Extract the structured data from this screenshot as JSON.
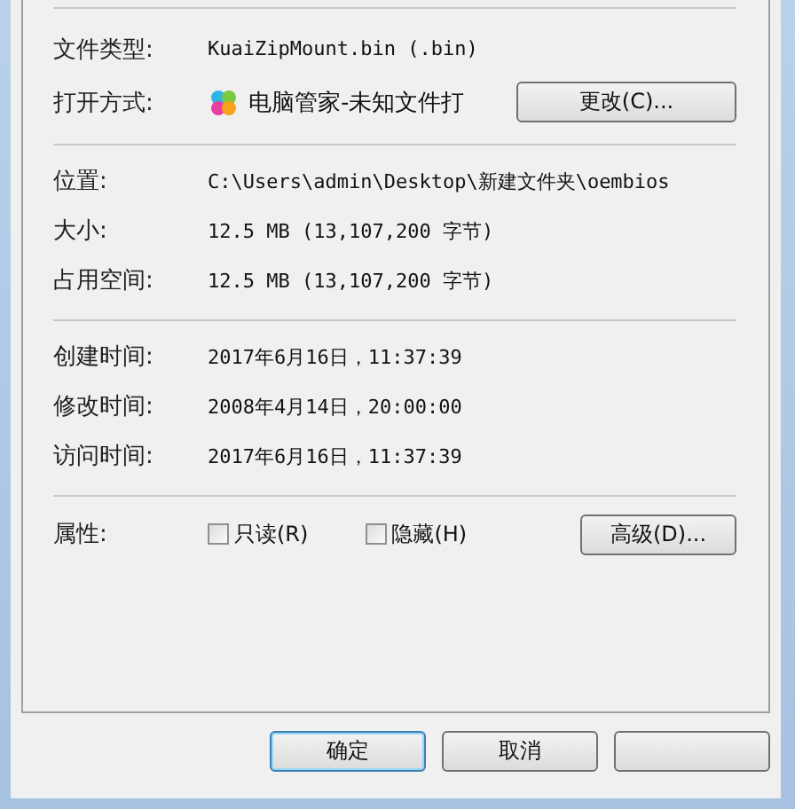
{
  "general": [
    {
      "label": "文件类型:",
      "value": "KuaiZipMount.bin (.bin)",
      "kind": "text"
    },
    {
      "label": "打开方式:",
      "value": "电脑管家-未知文件打",
      "kind": "app",
      "button": "更改(C)..."
    }
  ],
  "location": [
    {
      "label": "位置:",
      "value": "C:\\Users\\admin\\Desktop\\新建文件夹\\oembios"
    },
    {
      "label": "大小:",
      "value": "12.5 MB (13,107,200 字节)"
    },
    {
      "label": "占用空间:",
      "value": "12.5 MB (13,107,200 字节)"
    }
  ],
  "times": [
    {
      "label": "创建时间:",
      "value": "2017年6月16日，11:37:39"
    },
    {
      "label": "修改时间:",
      "value": "2008年4月14日，20:00:00"
    },
    {
      "label": "访问时间:",
      "value": "2017年6月16日，11:37:39"
    }
  ],
  "attributes": {
    "label": "属性:",
    "checkboxes": [
      {
        "label": "只读(R)",
        "checked": false
      },
      {
        "label": "隐藏(H)",
        "checked": false
      }
    ],
    "button": "高级(D)..."
  },
  "footer": [
    {
      "label": "确定",
      "default": true
    },
    {
      "label": "取消",
      "default": false
    },
    {
      "default": false
    }
  ]
}
